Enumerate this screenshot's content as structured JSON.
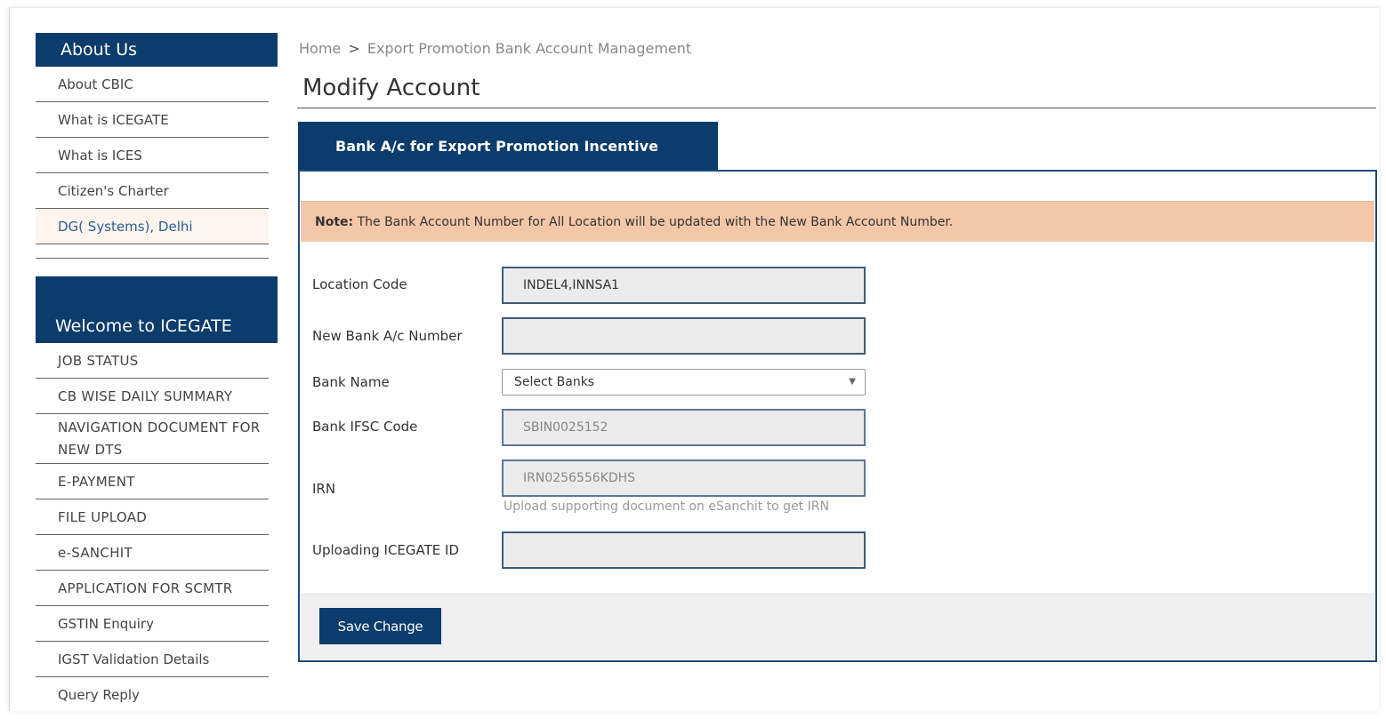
{
  "sidebar": {
    "about_heading": "About Us",
    "about_items": [
      {
        "label": "About CBIC"
      },
      {
        "label": "What is ICEGATE"
      },
      {
        "label": "What is ICES"
      },
      {
        "label": "Citizen's Charter"
      },
      {
        "label": "DG( Systems), Delhi"
      }
    ],
    "welcome_heading": "Welcome to ICEGATE",
    "welcome_items": [
      {
        "label": "JOB STATUS"
      },
      {
        "label": "CB WISE DAILY SUMMARY"
      },
      {
        "label": "NAVIGATION DOCUMENT FOR NEW DTS"
      },
      {
        "label": "E-PAYMENT"
      },
      {
        "label": "FILE UPLOAD"
      },
      {
        "label": "e-SANCHIT"
      },
      {
        "label": "APPLICATION FOR SCMTR"
      },
      {
        "label": "GSTIN Enquiry"
      },
      {
        "label": "IGST Validation Details"
      },
      {
        "label": "Query Reply"
      }
    ]
  },
  "breadcrumb": {
    "home": "Home",
    "separator": ">",
    "current": "Export Promotion Bank Account Management"
  },
  "page_title": "Modify Account",
  "tab_label": "Bank A/c for Export Promotion Incentive",
  "note": {
    "prefix": "Note:",
    "text": "The Bank Account Number for All Location will be updated with the New Bank Account Number."
  },
  "form": {
    "location_code": {
      "label": "Location Code",
      "value": "INDEL4,INNSA1"
    },
    "new_account": {
      "label": "New Bank A/c Number",
      "value": ""
    },
    "bank_name": {
      "label": "Bank Name",
      "selected": "Select Banks"
    },
    "ifsc": {
      "label": "Bank IFSC Code",
      "value": "SBIN0025152"
    },
    "irn": {
      "label": "IRN",
      "value": "IRN0256556KDHS",
      "hint": "Upload supporting document on eSanchit to get IRN"
    },
    "uploading_id": {
      "label": "Uploading ICEGATE ID",
      "value": ""
    }
  },
  "save_label": "Save Change",
  "colors": {
    "brand_navy": "#0b3c6b",
    "note_bg": "#f3c7a8"
  }
}
